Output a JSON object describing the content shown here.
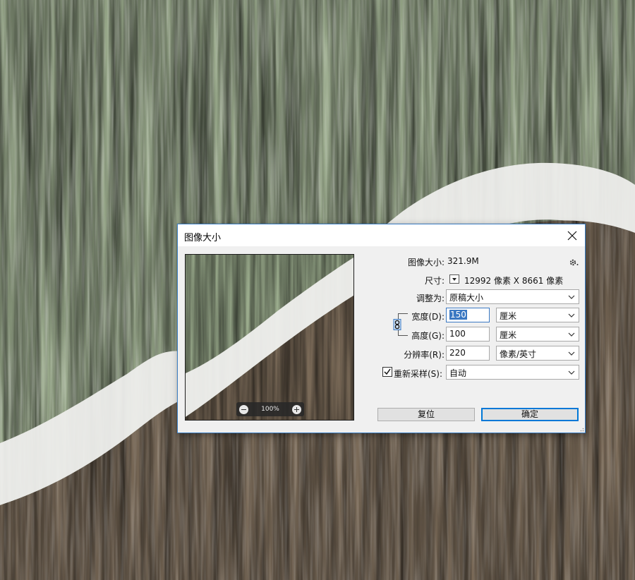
{
  "dialog": {
    "title": "图像大小",
    "image_size_label": "图像大小:",
    "image_size_value": "321.9M",
    "dimensions_label": "尺寸:",
    "dimensions_value": "12992 像素  X  8661 像素",
    "fit_to_label": "调整为:",
    "fit_to_value": "原稿大小",
    "width_label": "宽度(D):",
    "width_value": "150",
    "width_unit": "厘米",
    "height_label": "高度(G):",
    "height_value": "100",
    "height_unit": "厘米",
    "resolution_label": "分辨率(R):",
    "resolution_value": "220",
    "resolution_unit": "像素/英寸",
    "resample_label": "重新采样(S):",
    "resample_checked": true,
    "resample_value": "自动",
    "reset_button": "复位",
    "ok_button": "确定",
    "zoom_level": "100%"
  },
  "colors": {
    "dialog_bg": "#f0f0f0",
    "accent": "#3a78c2",
    "green_texture": "#7e8f6c",
    "brown_texture": "#5f5243",
    "white_stripe": "#f2f2f2"
  }
}
